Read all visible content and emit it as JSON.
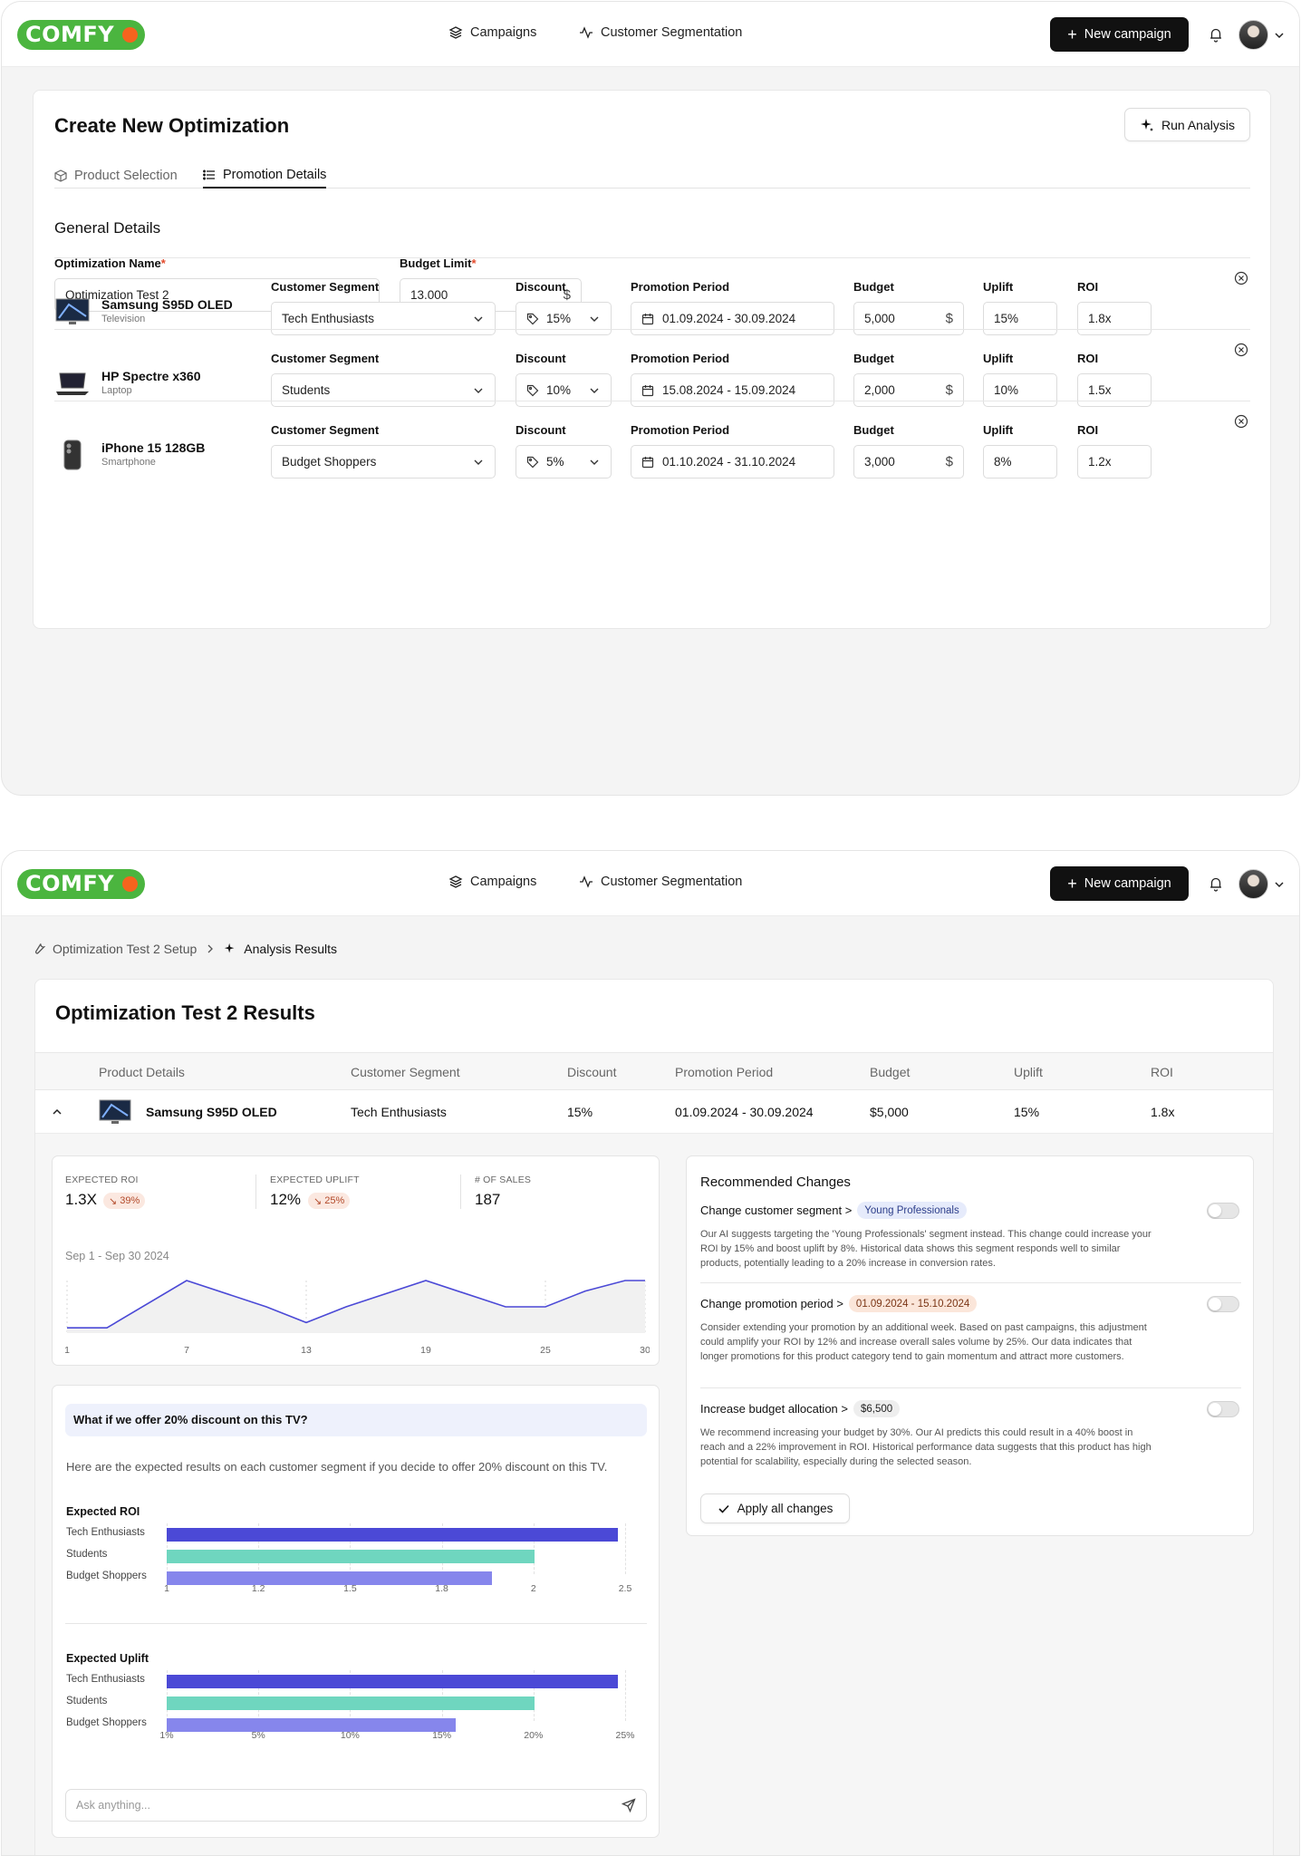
{
  "brand": {
    "logo_text": "COMFY",
    "accent": "#4bb53f",
    "dot": "#f5641e"
  },
  "nav": {
    "campaigns": "Campaigns",
    "segmentation": "Customer Segmentation",
    "new_campaign": "New campaign"
  },
  "optimization": {
    "title": "Create New Optimization",
    "run_analysis": "Run Analysis",
    "tabs": [
      "Product Selection",
      "Promotion Details"
    ],
    "active_tab": "Promotion Details",
    "general_title": "General Details",
    "name_label": "Optimization Name",
    "name_value": "Optimization Test 2",
    "budget_label": "Budget Limit",
    "budget_value": "13.000",
    "currency": "$",
    "col_labels": {
      "segment": "Customer Segment",
      "discount": "Discount",
      "period": "Promotion Period",
      "budget": "Budget",
      "uplift": "Uplift",
      "roi": "ROI"
    },
    "products": [
      {
        "name": "Samsung S95D  OLED",
        "category": "Television",
        "segment": "Tech Enthusiasts",
        "discount": "15%",
        "period": "01.09.2024 - 30.09.2024",
        "budget": "5,000",
        "uplift": "15%",
        "roi": "1.8x"
      },
      {
        "name": "HP Spectre x360",
        "category": "Laptop",
        "segment": "Students",
        "discount": "10%",
        "period": "15.08.2024 - 15.09.2024",
        "budget": "2,000",
        "uplift": "10%",
        "roi": "1.5x"
      },
      {
        "name": "iPhone 15 128GB",
        "category": "Smartphone",
        "segment": "Budget Shoppers",
        "discount": "5%",
        "period": "01.10.2024 - 31.10.2024",
        "budget": "3,000",
        "uplift": "8%",
        "roi": "1.2x"
      }
    ]
  },
  "results": {
    "breadcrumb": [
      "Optimization Test 2 Setup",
      "Analysis Results"
    ],
    "title": "Optimization Test 2 Results",
    "columns": [
      "Product Details",
      "Customer Segment",
      "Discount",
      "Promotion Period",
      "Budget",
      "Uplift",
      "ROI"
    ],
    "row": {
      "name": "Samsung S95D  OLED",
      "segment": "Tech Enthusiasts",
      "discount": "15%",
      "period": "01.09.2024 - 30.09.2024",
      "budget": "$5,000",
      "uplift": "15%",
      "roi": "1.8x"
    },
    "kpis": [
      {
        "label": "EXPECTED ROI",
        "value": "1.3X",
        "delta": "39%"
      },
      {
        "label": "EXPECTED UPLIFT",
        "value": "12%",
        "delta": "25%"
      },
      {
        "label": "# OF SALES",
        "value": "187"
      }
    ],
    "trend_range": "Sep 1 - Sep 30 2024",
    "trend_ticks": [
      "1",
      "7",
      "13",
      "19",
      "25",
      "30"
    ],
    "recommendations": {
      "title": "Recommended Changes",
      "items": [
        {
          "head": "Change customer segment >",
          "chip": "Young Professionals",
          "text": "Our AI suggests targeting the 'Young Professionals' segment instead. This change could increase your ROI by 15% and boost uplift by 8%. Historical data shows this segment responds well to similar products, potentially leading to a 20% increase in conversion rates."
        },
        {
          "head": "Change promotion period >",
          "chip": "01.09.2024 - 15.10.2024",
          "text": "Consider extending your promotion by an additional week. Based on past campaigns, this adjustment could amplify your ROI by 12% and increase overall sales volume by 25%. Our data indicates that longer promotions for this product category tend to gain momentum and attract more customers."
        },
        {
          "head": "Increase budget allocation >",
          "chip": "$6,500",
          "text": "We recommend increasing your budget by 30%. Our AI predicts this could result in a 40% boost in reach and a 22% improvement in ROI. Historical performance data suggests that this product has high potential for scalability, especially during the selected season."
        }
      ],
      "apply": "Apply all changes"
    },
    "whatif": {
      "question": "What if we offer 20% discount on this TV?",
      "answer": "Here are the expected results on each customer segment if you decide to offer 20% discount on this TV.",
      "ask_placeholder": "Ask anything..."
    }
  },
  "chart_data": [
    {
      "type": "line",
      "title": "",
      "x": [
        1,
        3,
        7,
        11,
        13,
        15,
        19,
        23,
        25,
        27,
        29,
        30
      ],
      "series": [
        {
          "values": [
            0.1,
            0.1,
            1.0,
            0.5,
            0.2,
            0.5,
            1.0,
            0.5,
            0.5,
            0.8,
            1.0,
            1.0
          ]
        }
      ],
      "xticks": [
        "1",
        "7",
        "13",
        "19",
        "25",
        "30"
      ],
      "color": "#4b49d6"
    },
    {
      "type": "bar",
      "title": "Expected ROI",
      "categories": [
        "Tech Enthusiasts",
        "Students",
        "Budget Shoppers"
      ],
      "values": [
        2.5,
        2.04,
        1.8
      ],
      "ticks": [
        "1",
        "1.2",
        "1.5",
        "1.8",
        "2",
        "2.5"
      ],
      "colors": [
        "#4b49d6",
        "#6fd6bf",
        "#8686ec"
      ]
    },
    {
      "type": "bar",
      "title": "Expected Uplift",
      "categories": [
        "Tech Enthusiasts",
        "Students",
        "Budget Shoppers"
      ],
      "values": [
        25,
        20.4,
        16
      ],
      "ticks": [
        "1%",
        "5%",
        "10%",
        "15%",
        "20%",
        "25%"
      ],
      "colors": [
        "#4b49d6",
        "#6fd6bf",
        "#8686ec"
      ]
    }
  ]
}
